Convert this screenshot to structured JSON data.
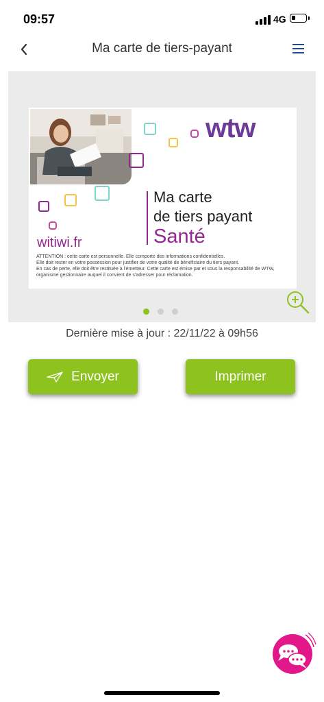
{
  "status_bar": {
    "time": "09:57",
    "network": "4G"
  },
  "nav": {
    "title": "Ma carte de tiers-payant"
  },
  "card": {
    "brand": "wtw",
    "title_line1": "Ma carte",
    "title_line2": "de tiers payant",
    "title_line3": "Santé",
    "website": "witiwi.fr",
    "notice": [
      "ATTENTION : cette carte est personnelle. Elle comporte des informations confidentielles.",
      "Elle doit rester en votre possession pour justifier de votre qualité de bénéficiaire du tiers payant.",
      "En cas de perte, elle doit être restituée à l'émetteur. Cette carte est émise par et sous la responsabilité de WTW,",
      "organisme gestionnaire auquel il convient de s'adresser pour réclamation."
    ]
  },
  "carousel": {
    "page_count": 3,
    "active_index": 0
  },
  "last_update": "Dernière mise à jour : 22/11/22 à 09h56",
  "actions": {
    "send_label": "Envoyer",
    "print_label": "Imprimer"
  },
  "colors": {
    "accent_green": "#8dc21f",
    "brand_purple": "#6e3a97",
    "magenta": "#93278f",
    "nav_blue": "#1f4c8f",
    "chat_pink": "#e2178a"
  },
  "icons": {
    "back": "chevron-left-icon",
    "menu": "hamburger-menu-icon",
    "zoom": "zoom-in-icon",
    "send": "paper-plane-icon",
    "chat": "chat-bubbles-icon"
  }
}
